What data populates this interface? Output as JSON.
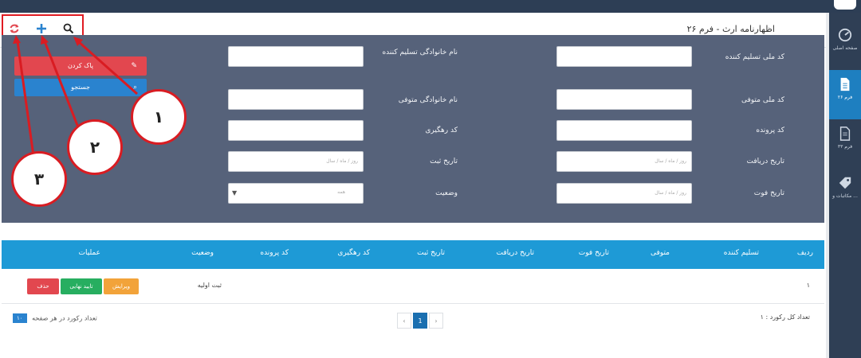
{
  "topbar": {
    "title": ""
  },
  "panel": {
    "title": "اظهارنامه ارث - فرم ۲۶"
  },
  "toolbar": {
    "search_icon": "search-icon",
    "add_icon": "plus-icon",
    "refresh_icon": "refresh-icon"
  },
  "sidebar": {
    "items": [
      {
        "label": "صفحه اصلی",
        "icon": "dashboard-icon"
      },
      {
        "label": "فرم ۲۶",
        "icon": "document-icon"
      },
      {
        "label": "فرم ۳۳",
        "icon": "document-icon"
      },
      {
        "label": "مکاتبات و ...",
        "icon": "tag-icon"
      }
    ]
  },
  "filters": {
    "giver_national_code": {
      "label": "کد ملی تسلیم کننده",
      "value": ""
    },
    "giver_family_name": {
      "label": "نام خانوادگی تسلیم کننده",
      "value": ""
    },
    "deceased_national_code": {
      "label": "کد ملی متوفی",
      "value": ""
    },
    "deceased_family_name": {
      "label": "نام خانوادگی متوفی",
      "value": ""
    },
    "file_code": {
      "label": "کد پرونده",
      "value": ""
    },
    "tracking_code": {
      "label": "کد رهگیری",
      "value": ""
    },
    "receive_date": {
      "label": "تاریخ دریافت",
      "placeholder": "روز / ماه / سال"
    },
    "register_date": {
      "label": "تاریخ ثبت",
      "placeholder": "روز / ماه / سال"
    },
    "death_date": {
      "label": "تاریخ فوت",
      "placeholder": "روز / ماه / سال"
    },
    "status": {
      "label": "وضعیت",
      "value": "همه"
    },
    "clear_label": "پاک کردن",
    "search_label": "جستجو"
  },
  "callouts": [
    "۱",
    "۲",
    "۳"
  ],
  "table": {
    "headers": [
      "ردیف",
      "تسلیم کننده",
      "متوفی",
      "تاریخ فوت",
      "تاریخ دریافت",
      "تاریخ ثبت",
      "کد رهگیری",
      "کد پرونده",
      "وضعیت",
      "عملیات"
    ],
    "rows": [
      {
        "index": "۱",
        "status": "ثبت اولیه"
      }
    ],
    "actions": {
      "edit": "ویرایش",
      "confirm": "تایید نهایی",
      "delete": "حذف"
    }
  },
  "footer": {
    "total_label": "تعداد کل رکورد : ۱",
    "per_page_label": "تعداد رکورد در هر صفحه",
    "per_page_value": "۱۰",
    "pager": {
      "prev": "‹",
      "current": "1",
      "next": "›"
    }
  },
  "colors": {
    "accent": "#1e9ad6",
    "filter_bg": "#56627a",
    "danger": "#e2474f",
    "primary": "#2a83cf",
    "warning": "#f2a33a",
    "success": "#27ae60",
    "highlight": "#d91c22"
  }
}
